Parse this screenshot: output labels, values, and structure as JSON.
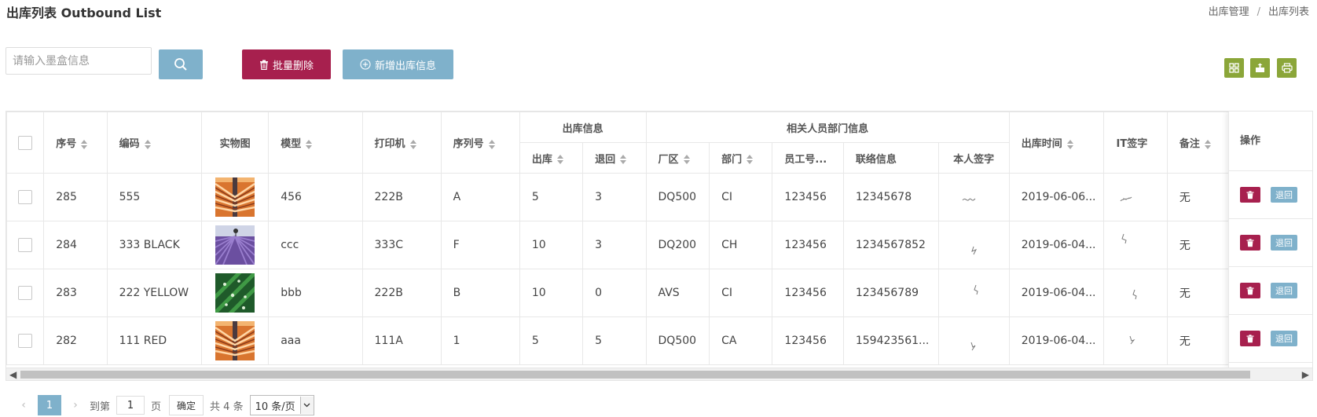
{
  "page": {
    "title": "出库列表 Outbound List"
  },
  "breadcrumb": {
    "parent": "出库管理",
    "separator": "/",
    "current": "出库列表"
  },
  "toolbar": {
    "search_placeholder": "请输入墨盒信息",
    "batch_delete": "批量删除",
    "add_outbound": "新增出库信息"
  },
  "table": {
    "headers": {
      "seq": "序号",
      "code": "编码",
      "photo": "实物图",
      "model": "模型",
      "printer": "打印机",
      "serial": "序列号",
      "outbound_group": "出库信息",
      "out": "出库",
      "returned": "退回",
      "staff_group": "相关人员部门信息",
      "factory": "厂区",
      "dept": "部门",
      "emp_no": "员工号...",
      "contact": "联络信息",
      "self_sign": "本人签字",
      "out_time": "出库时间",
      "it_sign": "IT签字",
      "remark": "备注",
      "actions": "操作"
    },
    "rows": [
      {
        "seq": "285",
        "code": "555",
        "model": "456",
        "printer": "222B",
        "serial": "A",
        "out": "5",
        "returned": "3",
        "factory": "DQ500",
        "dept": "CI",
        "emp_no": "123456",
        "contact": "12345678",
        "out_time": "2019-06-06...",
        "remark": "无",
        "return_label": "退回",
        "image": "orange-tunnel"
      },
      {
        "seq": "284",
        "code": "333 BLACK",
        "model": "ccc",
        "printer": "333C",
        "serial": "F",
        "out": "10",
        "returned": "3",
        "factory": "DQ200",
        "dept": "CH",
        "emp_no": "123456",
        "contact": "1234567852",
        "out_time": "2019-06-04...",
        "remark": "无",
        "return_label": "退回",
        "image": "lavender-field"
      },
      {
        "seq": "283",
        "code": "222 YELLOW",
        "model": "bbb",
        "printer": "222B",
        "serial": "B",
        "out": "10",
        "returned": "0",
        "factory": "AVS",
        "dept": "CI",
        "emp_no": "123456",
        "contact": "123456789",
        "out_time": "2019-06-04...",
        "remark": "无",
        "return_label": "退回",
        "image": "green-leaf-drops"
      },
      {
        "seq": "282",
        "code": "111 RED",
        "model": "aaa",
        "printer": "111A",
        "serial": "1",
        "out": "5",
        "returned": "5",
        "factory": "DQ500",
        "dept": "CA",
        "emp_no": "123456",
        "contact": "159423561...",
        "out_time": "2019-06-04...",
        "remark": "无",
        "return_label": "退回",
        "image": "orange-tunnel"
      }
    ]
  },
  "pager": {
    "current": "1",
    "goto_prefix": "到第",
    "goto_value": "1",
    "goto_suffix": "页",
    "confirm": "确定",
    "total": "共 4 条",
    "page_size": "10 条/页"
  },
  "colors": {
    "primary": "#7fb1cb",
    "danger": "#a7204e",
    "tool": "#8ba639"
  }
}
